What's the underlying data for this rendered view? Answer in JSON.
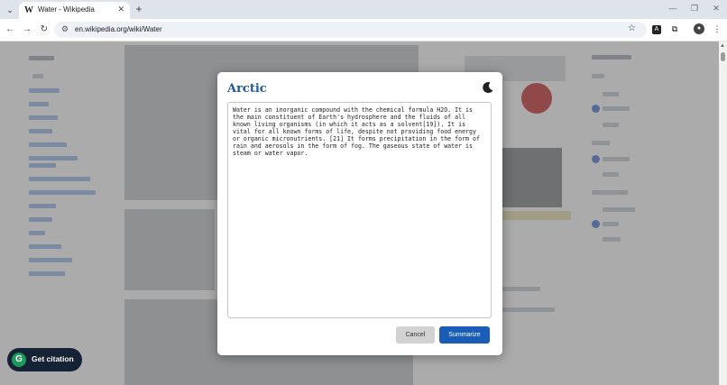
{
  "browser": {
    "tab_title": "Water - Wikipedia",
    "favicon_letter": "W",
    "url": "en.wikipedia.org/wiki/Water",
    "icons": {
      "tab_list": "chevron-down-icon",
      "close_tab": "close-icon",
      "new_tab": "plus-icon",
      "minimize": "minimize-icon",
      "restore": "restore-icon",
      "close_window": "close-icon",
      "back": "back-arrow-icon",
      "forward": "forward-arrow-icon",
      "reload": "reload-icon",
      "site_info": "tune-icon",
      "bookmark": "star-icon",
      "extension": "extension-icon",
      "puzzle": "puzzle-icon",
      "profile": "profile-icon",
      "menu": "kebab-menu-icon"
    }
  },
  "modal": {
    "title": "Arctic",
    "text": "Water is an inorganic compound with the chemical formula H2O. It is the main constituent of Earth's hydrosphere and the fluids of all known living organisms (in which it acts as a solvent[19]). It is vital for all known forms of life, despite not providing food energy or organic micronutrients. [21] It forms precipitation in the form of rain and aerosols in the form of fog. The gaseous state of water is steam or water vapor.",
    "cancel_label": "Cancel",
    "summarize_label": "Summarize",
    "theme_icon": "moon-icon"
  },
  "citation": {
    "label": "Get citation",
    "logo_letter": "G"
  },
  "colors": {
    "title_blue": "#1f5a96",
    "primary_button": "#1a5db6",
    "citation_bg": "#162235",
    "citation_logo": "#1d9a57"
  }
}
